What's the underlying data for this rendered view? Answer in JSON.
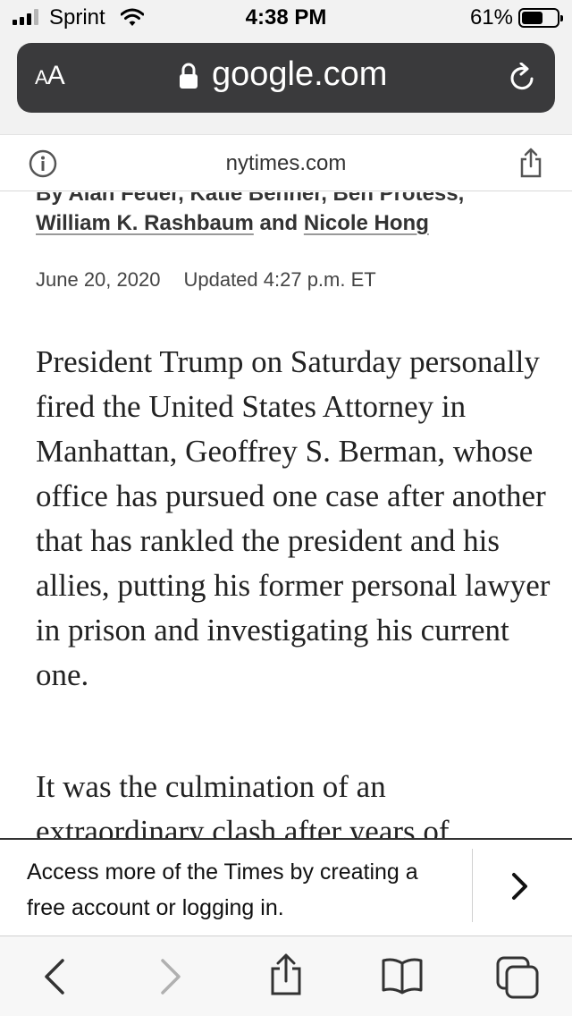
{
  "status_bar": {
    "carrier": "Sprint",
    "time": "4:38 PM",
    "battery_percent": "61%",
    "battery_level": 0.61,
    "signal_bars": 3
  },
  "browser": {
    "text_size_label": "AA",
    "url": "google.com",
    "site_domain": "nytimes.com"
  },
  "article": {
    "byline_partial": "By Alan Feuer, Katie Benner, Ben Protess,",
    "byline_line2": {
      "author1": "William K. Rashbaum",
      "connector": " and ",
      "author2": "Nicole Hong"
    },
    "date": "June 20, 2020",
    "updated": "Updated 4:27 p.m. ET",
    "paragraph1": "President Trump on Saturday personally fired the United States Attorney in Manhattan, Geoffrey S. Berman, whose office has pursued one case after another that has rankled the president and his allies, putting his former personal lawyer in prison and investigating his current one.",
    "paragraph2": "It was the culmination of an extraordinary clash after years of"
  },
  "promo": {
    "text": "Access more of the Times by creating a free account or logging in."
  },
  "icons": {
    "signal": "signal-icon",
    "wifi": "wifi-icon",
    "battery": "battery-icon",
    "lock": "lock-icon",
    "reload": "reload-icon",
    "info": "info-icon",
    "share": "share-icon",
    "chevron": "chevron-right-icon",
    "back": "back-icon",
    "forward": "forward-icon",
    "bookmarks": "bookmarks-icon",
    "tabs": "tabs-icon"
  }
}
